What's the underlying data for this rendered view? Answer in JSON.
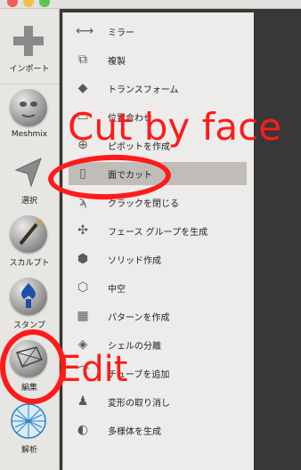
{
  "window": {
    "traffic_lights": {
      "close": "#ee5f57",
      "minimize": "#f6be4f",
      "zoom": "#5fc454"
    }
  },
  "tools": [
    {
      "label": "インポート",
      "icon": "plus-icon"
    },
    {
      "label": "Meshmix",
      "icon": "face-sphere-icon"
    },
    {
      "label": "選択",
      "icon": "cursor-arrow-icon"
    },
    {
      "label": "スカルプト",
      "icon": "brush-sphere-icon"
    },
    {
      "label": "スタンプ",
      "icon": "stamp-sphere-icon"
    },
    {
      "label": "編集",
      "icon": "edit-sphere-icon"
    },
    {
      "label": "解析",
      "icon": "mesh-sphere-icon"
    }
  ],
  "menu": {
    "items": [
      {
        "label": "ミラー",
        "icon": "mirror-icon"
      },
      {
        "label": "複製",
        "icon": "duplicate-icon"
      },
      {
        "label": "トランスフォーム",
        "icon": "transform-icon"
      },
      {
        "label": "位置合わせ",
        "icon": "align-icon"
      },
      {
        "label": "ピボットを作成",
        "icon": "pivot-icon"
      },
      {
        "label": "面でカット",
        "icon": "plane-cut-icon"
      },
      {
        "label": "クラックを閉じる",
        "icon": "close-cracks-icon"
      },
      {
        "label": "フェース グループを生成",
        "icon": "face-groups-icon"
      },
      {
        "label": "ソリッド作成",
        "icon": "make-solid-icon"
      },
      {
        "label": "中空",
        "icon": "hollow-icon"
      },
      {
        "label": "パターンを作成",
        "icon": "pattern-icon"
      },
      {
        "label": "シェルの分離",
        "icon": "separate-shells-icon"
      },
      {
        "label": "チューブを追加",
        "icon": "add-tube-icon"
      },
      {
        "label": "変形の取り消し",
        "icon": "undo-deform-icon"
      },
      {
        "label": "多様体を生成",
        "icon": "manifold-icon"
      }
    ],
    "active_index": 5
  },
  "annotations": {
    "cut_label": "Cut by face",
    "edit_label": "Edit",
    "color": "#ff1a1a"
  }
}
